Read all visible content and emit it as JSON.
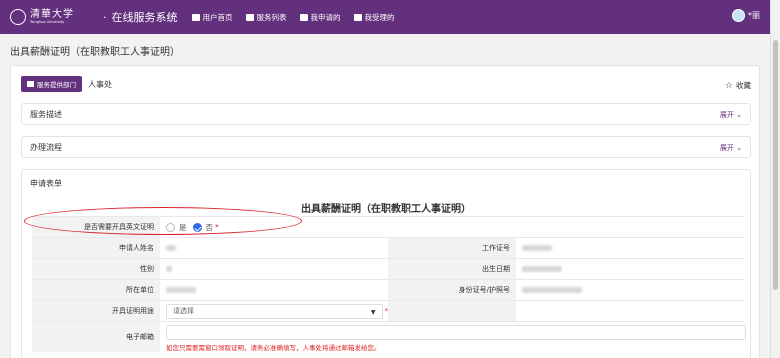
{
  "header": {
    "logo_cn": "清華大学",
    "logo_en": "Tsinghua University",
    "system_title": "在线服务系统",
    "nav": [
      {
        "label": "用户首页",
        "icon": "home-icon"
      },
      {
        "label": "服务列表",
        "icon": "edit-icon"
      },
      {
        "label": "我申请的",
        "icon": "list-icon"
      },
      {
        "label": "我受理的",
        "icon": "list-icon"
      }
    ],
    "user_name": "*丽"
  },
  "page": {
    "title": "出具薪酬证明（在职教职工人事证明）"
  },
  "service": {
    "dept_button": "服务提供部门",
    "dept_name": "人事处",
    "favorite_label": "收藏"
  },
  "sections": [
    {
      "label": "服务描述",
      "action": "展开"
    },
    {
      "label": "办理流程",
      "action": "展开"
    }
  ],
  "form": {
    "header": "申请表单",
    "title": "出具薪酬证明（在职教职工人事证明）",
    "english_cert": {
      "label": "是否需要开具英文证明",
      "options": [
        "是",
        "否"
      ],
      "selected": "否",
      "required_mark": "*"
    },
    "fields": {
      "applicant_name_label": "申请人姓名",
      "work_id_label": "工作证号",
      "gender_label": "性别",
      "birth_date_label": "出生日期",
      "unit_label": "所在单位",
      "id_number_label": "身份证号/护照号",
      "purpose_label": "开具证明用途",
      "purpose_placeholder": "请选择",
      "purpose_required": "*",
      "email_label": "电子邮箱",
      "email_hint": "如您只需要需窗口领取证明，请务必准确填写，人事处将通过邮箱发给您。"
    }
  },
  "colors": {
    "brand": "#63307e",
    "required": "#e02020",
    "check": "#2e6be6",
    "annotation": "#d9232a"
  }
}
